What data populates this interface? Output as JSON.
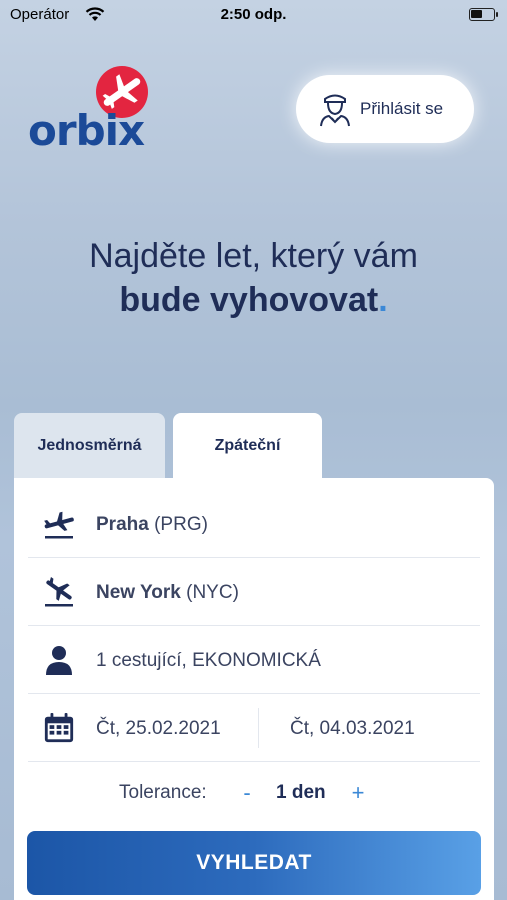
{
  "status_bar": {
    "carrier": "Operátor",
    "time": "2:50 odp.",
    "wifi_icon": "wifi-icon",
    "battery_icon": "battery-icon"
  },
  "brand": {
    "name": "orbix",
    "accent_color": "#e32540",
    "text_color": "#1b4a98",
    "icon": "airplane-icon"
  },
  "login": {
    "label": "Přihlásit se",
    "icon": "pilot-icon"
  },
  "headline": {
    "line1": "Najděte let, který vám",
    "line2_bold": "bude vyhovovat",
    "line2_dot": "."
  },
  "tabs": [
    {
      "label": "Jednosměrná",
      "selected": false
    },
    {
      "label": "Zpáteční",
      "selected": true
    }
  ],
  "form": {
    "from": {
      "city": "Praha",
      "code": "(PRG)",
      "icon": "departure-icon"
    },
    "to": {
      "city": "New York",
      "code": "(NYC)",
      "icon": "arrival-icon"
    },
    "passengers": {
      "text": "1 cestující, EKONOMICKÁ",
      "icon": "person-icon"
    },
    "dates": {
      "departure": "Čt, 25.02.2021",
      "return": "Čt, 04.03.2021",
      "icon": "calendar-icon"
    },
    "tolerance": {
      "label": "Tolerance:",
      "minus": "-",
      "value": "1 den",
      "plus": "+"
    }
  },
  "search_button": {
    "label": "VYHLEDAT"
  },
  "colors": {
    "primary_dark": "#1f2d57",
    "accent_blue": "#3b88d6",
    "button_gradient_start": "#1c56a7",
    "button_gradient_end": "#59a0e6"
  }
}
